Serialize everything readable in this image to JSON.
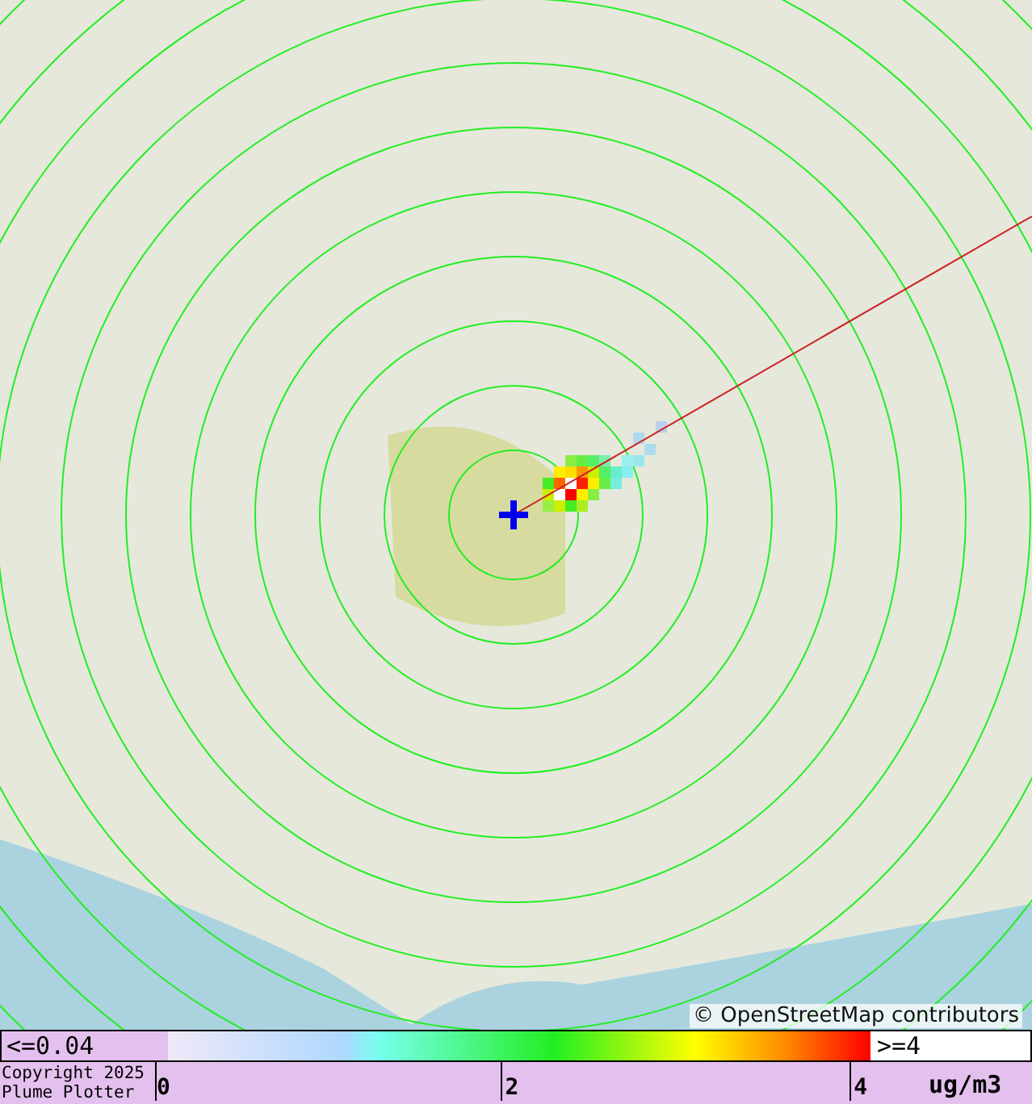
{
  "map": {
    "attribution": "© OpenStreetMap contributors"
  },
  "legend": {
    "low_label": "<=0.04",
    "high_label": ">=4",
    "ticks": [
      "0",
      "2",
      "4"
    ],
    "units": "ug/m3"
  },
  "footer": {
    "lines": [
      "Copyright 2025",
      "Plume Plotter"
    ]
  }
}
